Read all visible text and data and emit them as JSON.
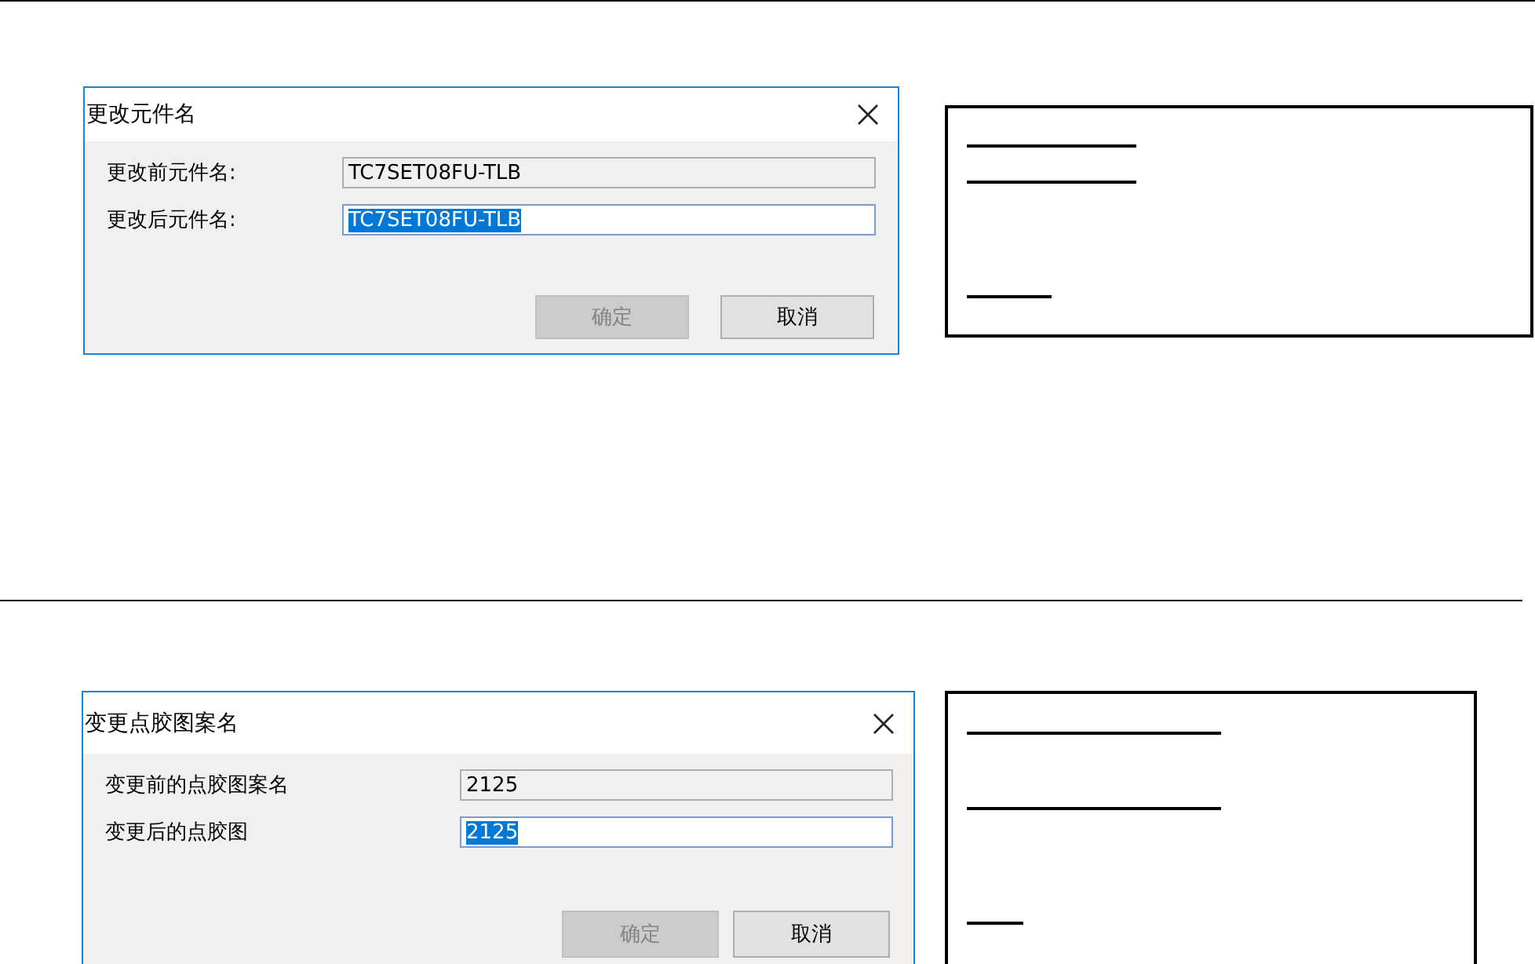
{
  "sections": [
    {
      "dialog": {
        "title": "更改元件名",
        "fields": [
          {
            "label": "更改前元件名:",
            "value": "TC7SET08FU-TLB",
            "readonly": true,
            "selected": false
          },
          {
            "label": "更改后元件名:",
            "value": "TC7SET08FU-TLB",
            "readonly": false,
            "selected": true
          }
        ],
        "buttons": [
          {
            "label": "确定",
            "disabled": true
          },
          {
            "label": "取消",
            "disabled": false
          }
        ]
      },
      "note_box": {
        "blanks": [
          {
            "kind": "long"
          },
          {
            "kind": "long"
          },
          {
            "kind": "short"
          }
        ]
      }
    },
    {
      "dialog": {
        "title": "变更点胶图案名",
        "fields": [
          {
            "label": "变更前的点胶图案名",
            "value": "2125",
            "readonly": true,
            "selected": false
          },
          {
            "label": "变更后的点胶图",
            "value": "2125",
            "readonly": false,
            "selected": true
          }
        ],
        "buttons": [
          {
            "label": "确定",
            "disabled": true
          },
          {
            "label": "取消",
            "disabled": false
          }
        ]
      },
      "note_box": {
        "blanks": [
          {
            "kind": "long"
          },
          {
            "kind": "long"
          },
          {
            "kind": "short"
          }
        ]
      }
    }
  ]
}
